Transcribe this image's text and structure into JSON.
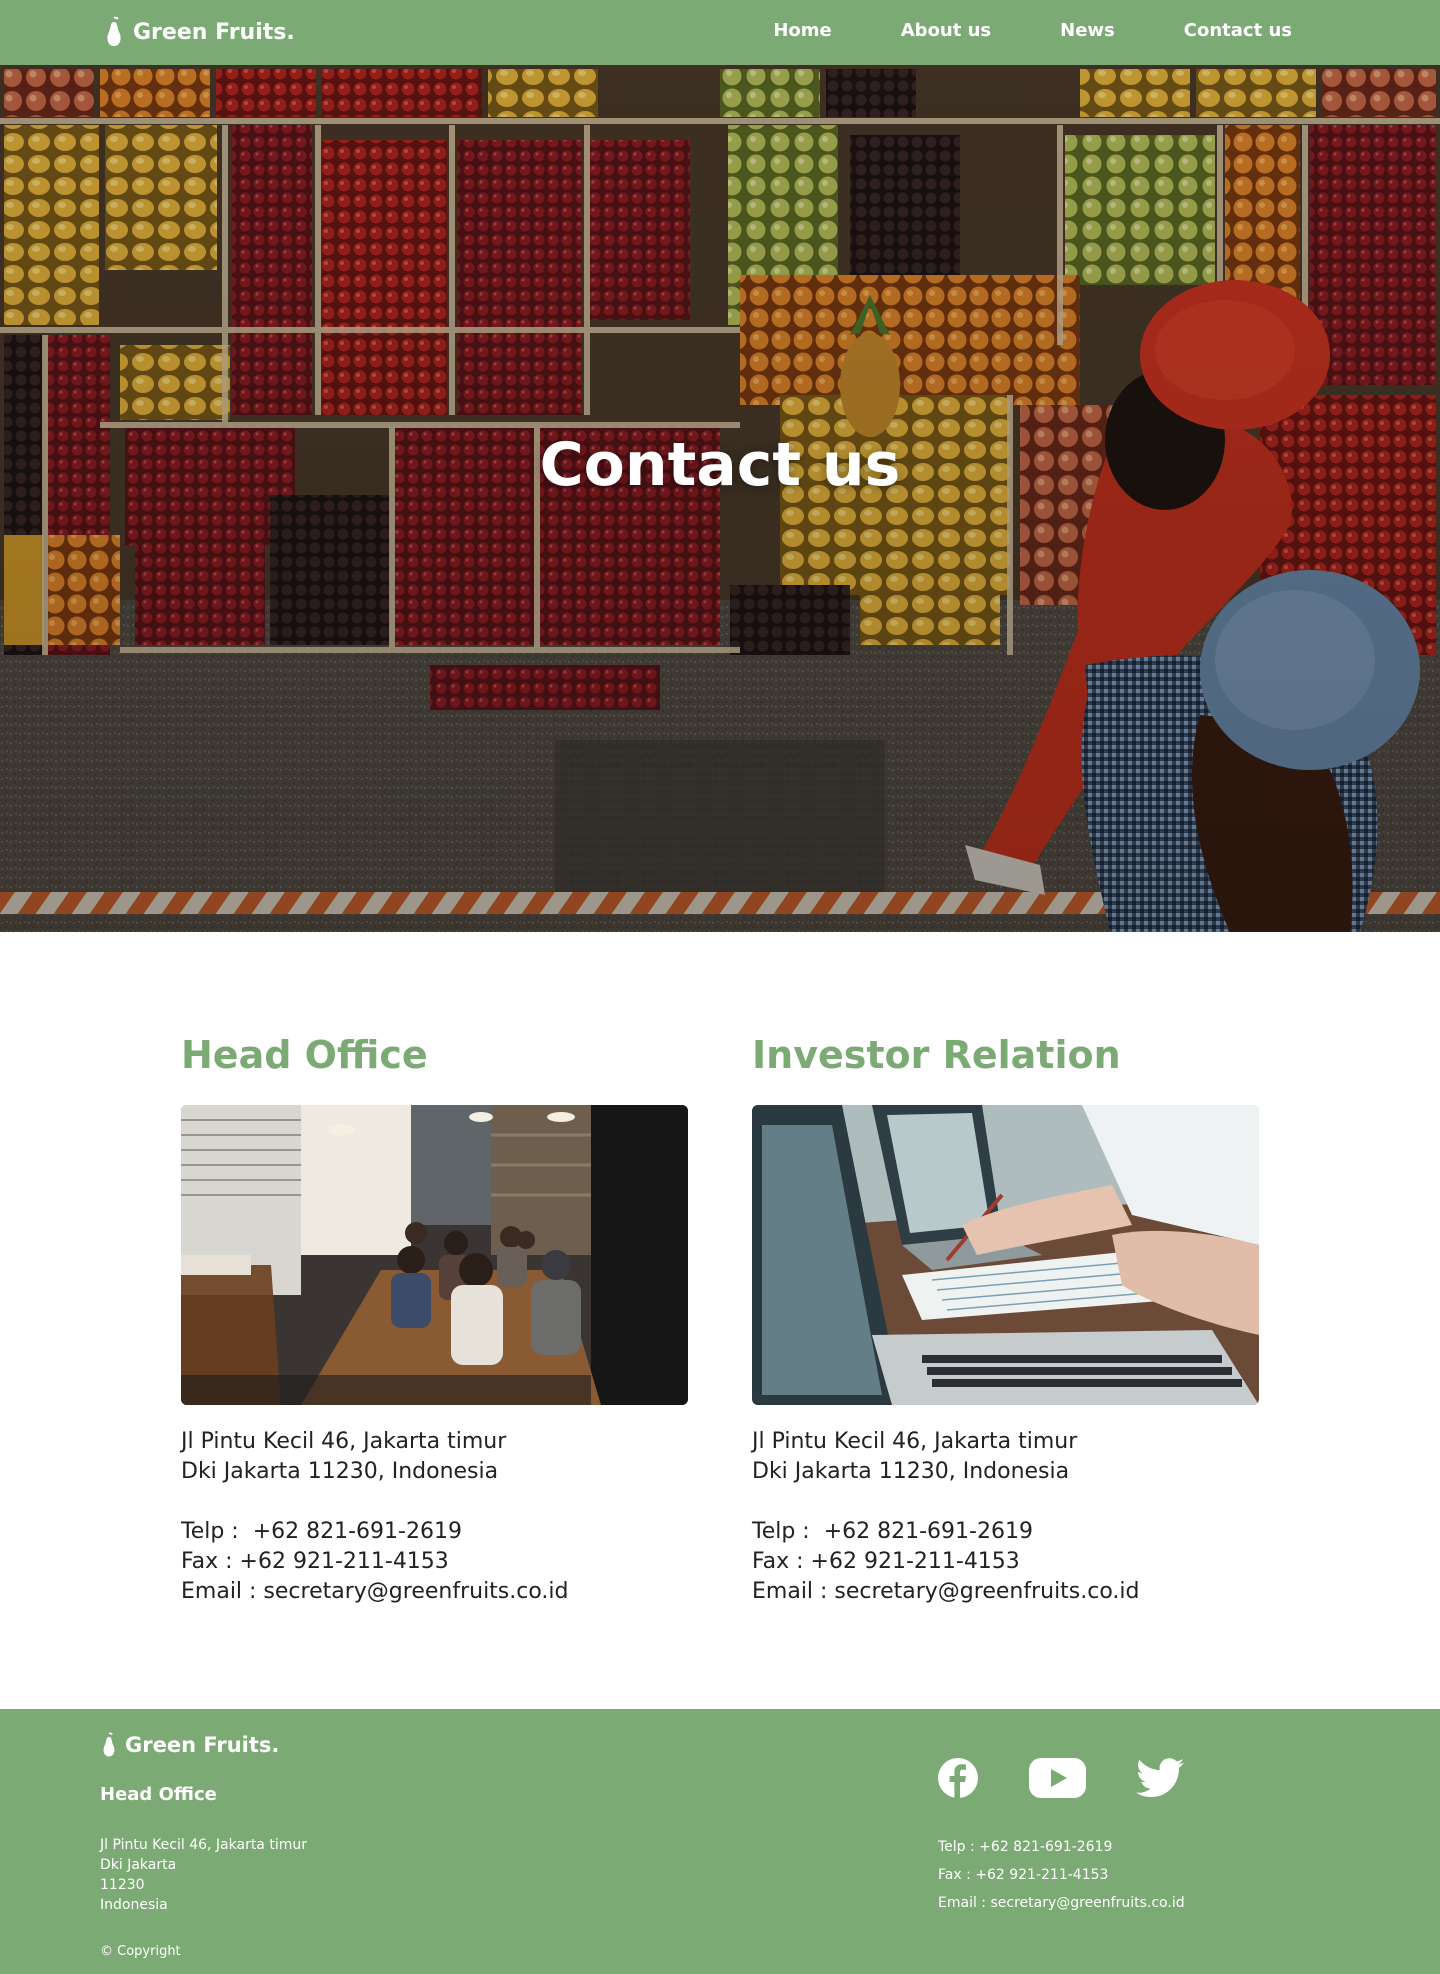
{
  "nav": {
    "brand": "Green Fruits.",
    "links": [
      {
        "label": "Home"
      },
      {
        "label": "About us"
      },
      {
        "label": "News"
      },
      {
        "label": "Contact us"
      }
    ]
  },
  "hero": {
    "title": "Contact us"
  },
  "offices": [
    {
      "title": "Head Office",
      "address_line1": "Jl Pintu Kecil 46, Jakarta timur",
      "address_line2": "Dki Jakarta 11230, Indonesia",
      "telp": "Telp :  +62 821-691-2619",
      "fax": "Fax : +62 921-211-4153",
      "email": "Email : secretary@greenfruits.co.id"
    },
    {
      "title": "Investor Relation",
      "address_line1": "Jl Pintu Kecil 46, Jakarta timur",
      "address_line2": "Dki Jakarta 11230, Indonesia",
      "telp": "Telp :  +62 821-691-2619",
      "fax": "Fax : +62 921-211-4153",
      "email": "Email : secretary@greenfruits.co.id"
    }
  ],
  "footer": {
    "brand": "Green Fruits.",
    "heading": "Head Office",
    "address": [
      "Jl Pintu Kecil 46, Jakarta timur",
      "Dki Jakarta",
      "11230",
      "Indonesia"
    ],
    "copyright": "© Copyright",
    "socials": [
      {
        "icon": "facebook-icon"
      },
      {
        "icon": "youtube-icon"
      },
      {
        "icon": "twitter-icon"
      }
    ],
    "telp": "Telp : +62 821-691-2619",
    "fax": "Fax : +62 921-211-4153",
    "email": "Email : secretary@greenfruits.co.id"
  },
  "colors": {
    "brand_green": "#7caa74",
    "text": "#222222",
    "white": "#ffffff"
  }
}
